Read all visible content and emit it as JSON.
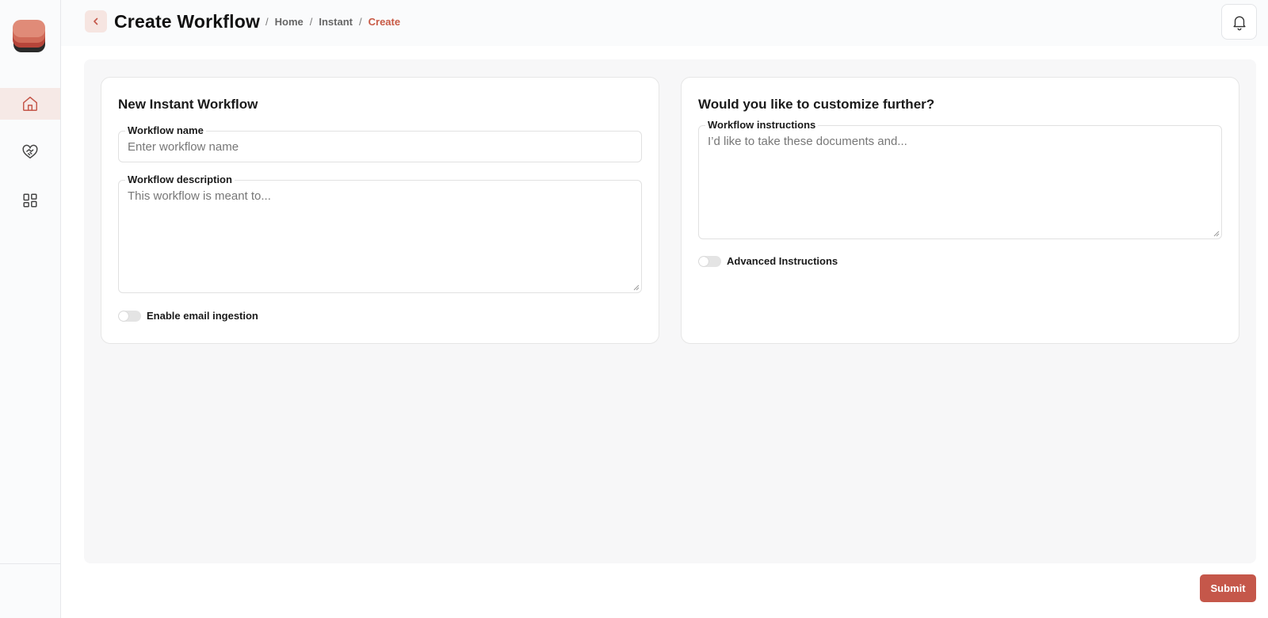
{
  "app": {
    "brand_accent": "#c5574a"
  },
  "sidebar": {
    "items": [
      {
        "icon": "home-icon",
        "active": true
      },
      {
        "icon": "heart-handshake-icon",
        "active": false
      },
      {
        "icon": "grid-icon",
        "active": false
      }
    ]
  },
  "header": {
    "title": "Create Workflow",
    "breadcrumb": [
      "Home",
      "Instant",
      "Create"
    ]
  },
  "left_card": {
    "title": "New Instant Workflow",
    "name_label": "Workflow name",
    "name_placeholder": "Enter workflow name",
    "name_value": "",
    "description_label": "Workflow description",
    "description_placeholder": "This workflow is meant to...",
    "description_value": "",
    "email_toggle_label": "Enable email ingestion",
    "email_toggle_on": false
  },
  "right_card": {
    "title": "Would you like to customize further?",
    "instructions_label": "Workflow instructions",
    "instructions_placeholder": "I’d like to take these documents and...",
    "instructions_value": "",
    "advanced_toggle_label": "Advanced Instructions",
    "advanced_toggle_on": false
  },
  "footer": {
    "submit_label": "Submit"
  }
}
